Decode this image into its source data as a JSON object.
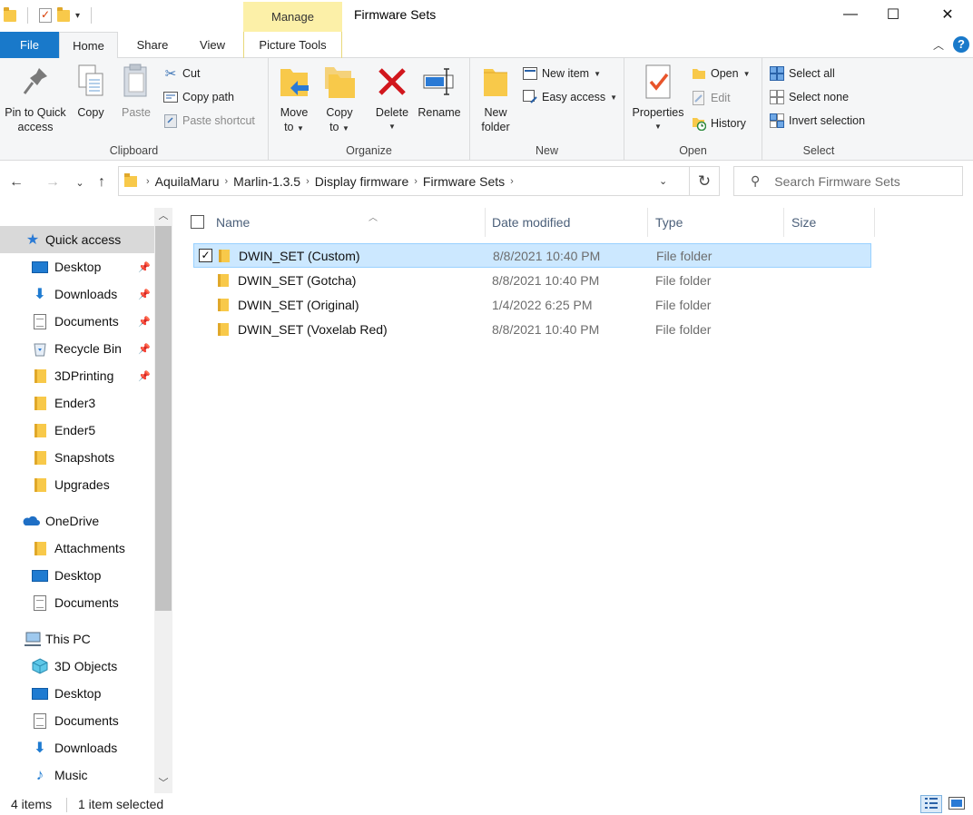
{
  "window": {
    "title": "Firmware Sets",
    "context_tab": "Manage",
    "minimize": "—",
    "maximize": "☐",
    "close": "✕"
  },
  "ribbon_tabs": {
    "file": "File",
    "home": "Home",
    "share": "Share",
    "view": "View",
    "picture_tools": "Picture Tools"
  },
  "ribbon": {
    "clipboard": {
      "label": "Clipboard",
      "pin_line1": "Pin to Quick",
      "pin_line2": "access",
      "copy": "Copy",
      "paste": "Paste",
      "cut": "Cut",
      "copy_path": "Copy path",
      "paste_shortcut": "Paste shortcut"
    },
    "organize": {
      "label": "Organize",
      "move_line1": "Move",
      "move_line2": "to",
      "copy_line1": "Copy",
      "copy_line2": "to",
      "delete": "Delete",
      "rename": "Rename"
    },
    "new": {
      "label": "New",
      "folder_line1": "New",
      "folder_line2": "folder",
      "new_item": "New item",
      "easy_access": "Easy access"
    },
    "open": {
      "label": "Open",
      "properties": "Properties",
      "open": "Open",
      "edit": "Edit",
      "history": "History"
    },
    "select": {
      "label": "Select",
      "select_all": "Select all",
      "select_none": "Select none",
      "invert": "Invert selection"
    }
  },
  "address": {
    "crumbs": [
      "AquilaMaru",
      "Marlin-1.3.5",
      "Display firmware",
      "Firmware Sets"
    ],
    "search_placeholder": "Search Firmware Sets"
  },
  "nav": {
    "quick_access": "Quick access",
    "items": [
      {
        "label": "Desktop",
        "icon": "desktop-icon",
        "pinned": true
      },
      {
        "label": "Downloads",
        "icon": "download-icon",
        "pinned": true
      },
      {
        "label": "Documents",
        "icon": "document-icon",
        "pinned": true
      },
      {
        "label": "Recycle Bin",
        "icon": "recycle-bin-icon",
        "pinned": true
      },
      {
        "label": "3DPrinting",
        "icon": "folder-icon",
        "pinned": true
      },
      {
        "label": "Ender3",
        "icon": "folder-icon",
        "pinned": false
      },
      {
        "label": "Ender5",
        "icon": "folder-icon",
        "pinned": false
      },
      {
        "label": "Snapshots",
        "icon": "folder-icon",
        "pinned": false
      },
      {
        "label": "Upgrades",
        "icon": "folder-icon",
        "pinned": false
      }
    ],
    "onedrive": "OneDrive",
    "onedrive_items": [
      "Attachments",
      "Desktop",
      "Documents"
    ],
    "this_pc": "This PC",
    "pc_items": [
      "3D Objects",
      "Desktop",
      "Documents",
      "Downloads",
      "Music"
    ]
  },
  "columns": {
    "name": "Name",
    "date": "Date modified",
    "type": "Type",
    "size": "Size"
  },
  "files": [
    {
      "name": "DWIN_SET (Custom)",
      "date": "8/8/2021 10:40 PM",
      "type": "File folder",
      "selected": true
    },
    {
      "name": "DWIN_SET (Gotcha)",
      "date": "8/8/2021 10:40 PM",
      "type": "File folder",
      "selected": false
    },
    {
      "name": "DWIN_SET (Original)",
      "date": "1/4/2022 6:25 PM",
      "type": "File folder",
      "selected": false
    },
    {
      "name": "DWIN_SET (Voxelab Red)",
      "date": "8/8/2021 10:40 PM",
      "type": "File folder",
      "selected": false
    }
  ],
  "status": {
    "count": "4 items",
    "selected": "1 item selected"
  },
  "colors": {
    "file_tab": "#1979ca",
    "manage_tab": "#fcf0a8",
    "selection": "#cce8ff",
    "selection_border": "#99d1ff"
  }
}
